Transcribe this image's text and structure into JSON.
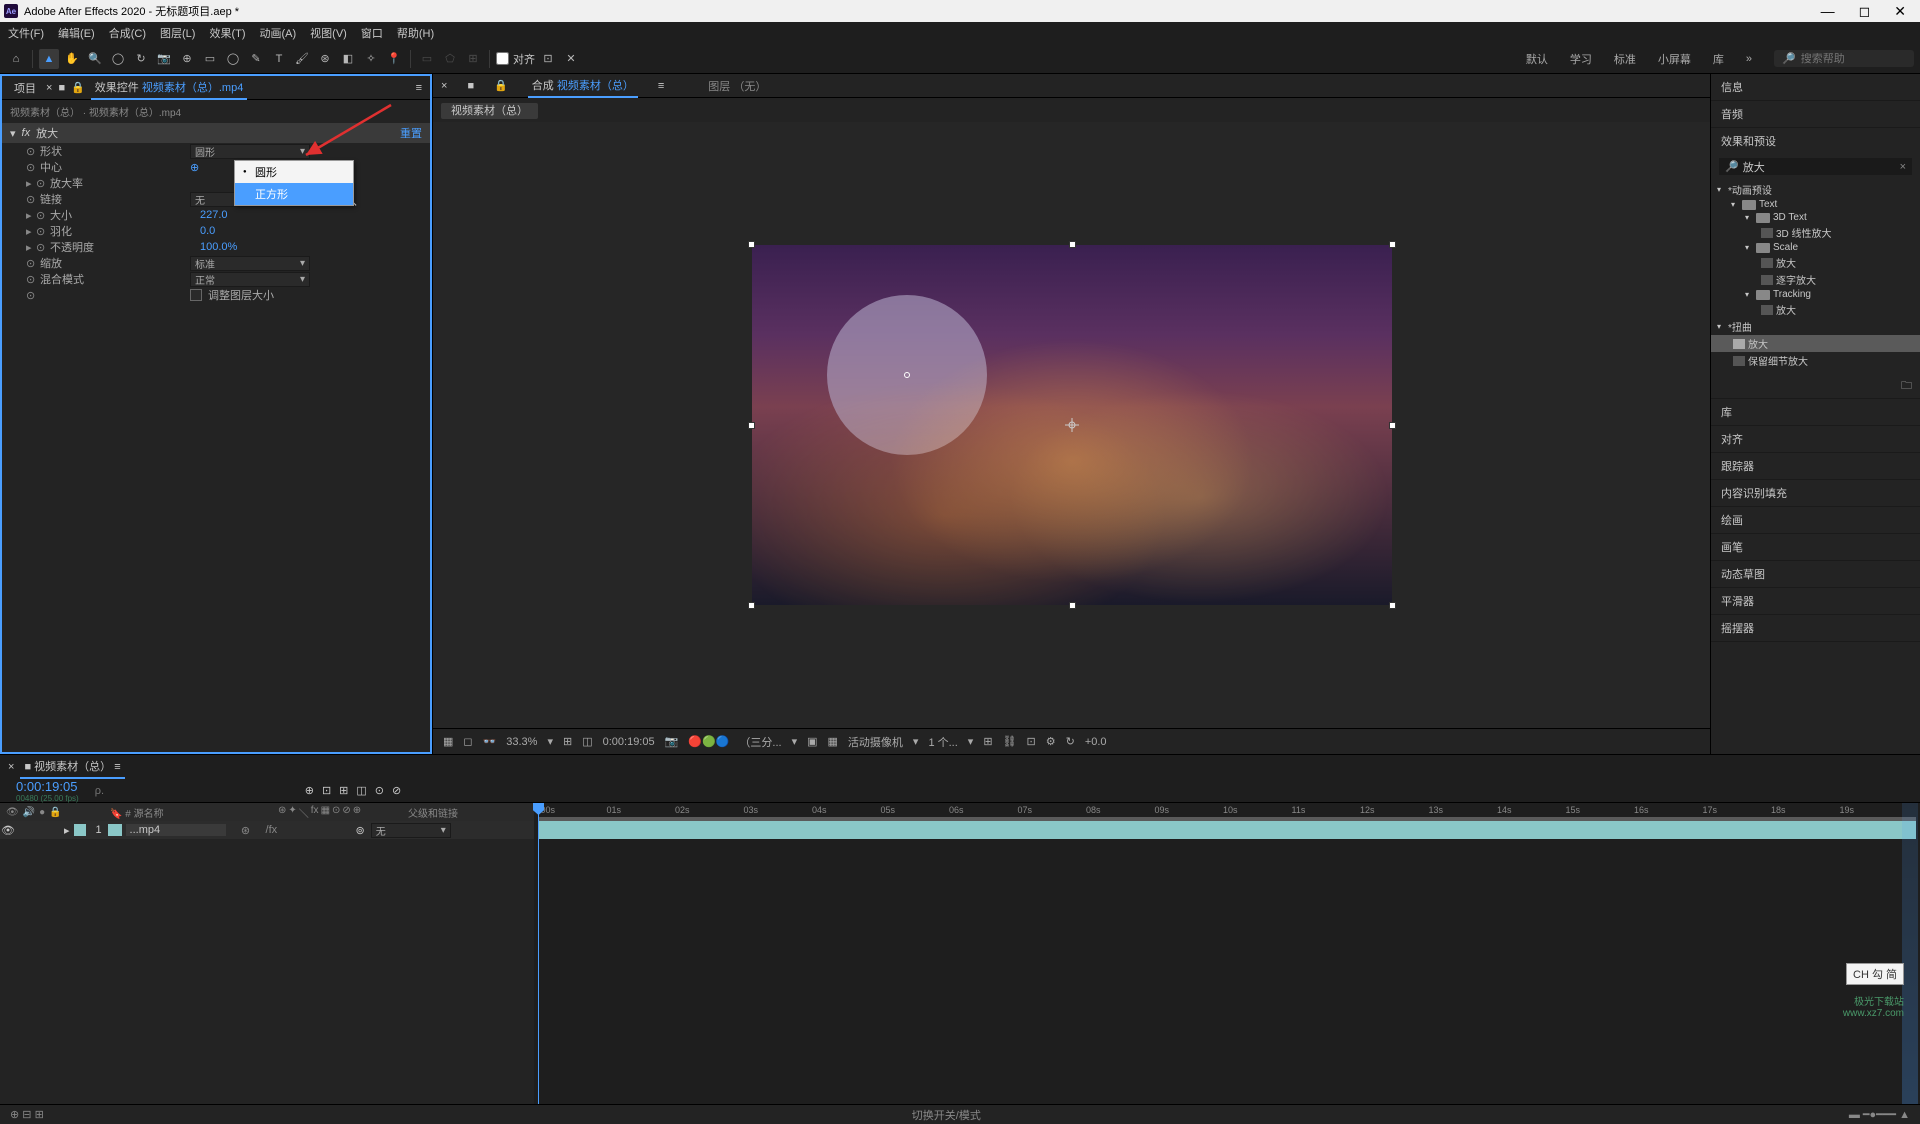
{
  "titlebar": {
    "app": "Adobe After Effects 2020",
    "doc": "无标题项目.aep *",
    "ae": "Ae"
  },
  "menu": [
    "文件(F)",
    "编辑(E)",
    "合成(C)",
    "图层(L)",
    "效果(T)",
    "动画(A)",
    "视图(V)",
    "窗口",
    "帮助(H)"
  ],
  "toolbar": {
    "align": "对齐",
    "workspaces": [
      "默认",
      "学习",
      "标准",
      "小屏幕",
      "库"
    ],
    "search_ph": "搜索帮助"
  },
  "left": {
    "tabs": {
      "project": "项目",
      "controls_prefix": "效果控件",
      "controls_link": "视频素材（总）.mp4"
    },
    "sub": "视频素材（总） · 视频素材（总）.mp4",
    "effect_name": "放大",
    "reset": "重置",
    "props": {
      "shape": "形状",
      "shape_val": "圆形",
      "center": "中心",
      "mag": "放大率",
      "link": "链接",
      "link_val": "无",
      "size": "大小",
      "size_val": "227.0",
      "feather": "羽化",
      "feather_val": "0.0",
      "opacity": "不透明度",
      "opacity_val": "100.0%",
      "scaling": "缩放",
      "scaling_val": "标准",
      "blend": "混合模式",
      "blend_val": "正常",
      "resize": "调整图层大小"
    },
    "dropdown": {
      "opt1": "圆形",
      "opt2": "正方形"
    }
  },
  "center": {
    "tabs": {
      "comp_prefix": "合成",
      "comp_link": "视频素材（总）",
      "layer": "图层 （无）"
    },
    "sub_comp": "视频素材（总）",
    "footer": {
      "zoom": "33.3%",
      "time": "0:00:19:05",
      "res": "（三分...",
      "camera": "活动摄像机",
      "views": "1 个...",
      "exposure": "+0.0"
    }
  },
  "right": {
    "sections": [
      "信息",
      "音频",
      "效果和预设",
      "库",
      "对齐",
      "跟踪器",
      "内容识别填充",
      "绘画",
      "画笔",
      "动态草图",
      "平滑器",
      "摇摆器"
    ],
    "search_val": "放大",
    "tree": {
      "anim": "*动画预设",
      "text": "Text",
      "text3d": "3D Text",
      "linear": "3D 线性放大",
      "scale": "Scale",
      "scale_1": "放大",
      "scale_2": "逐字放大",
      "tracking": "Tracking",
      "tracking_1": "放大",
      "distort": "*扭曲",
      "distort_1": "放大",
      "distort_2": "保留细节放大"
    }
  },
  "timeline": {
    "tab": "视频素材（总）",
    "time": "0:00:19:05",
    "time_sub": "00480 (25.00 fps)",
    "search_ph": "ρ.",
    "cols": {
      "source": "源名称",
      "parent": "父级和链接"
    },
    "layer": {
      "num": "1",
      "name": "...mp4",
      "fx": "/fx",
      "parent": "无"
    },
    "ticks": [
      ":00s",
      "01s",
      "02s",
      "03s",
      "04s",
      "05s",
      "06s",
      "07s",
      "08s",
      "09s",
      "10s",
      "11s",
      "12s",
      "13s",
      "14s",
      "15s",
      "16s",
      "17s",
      "18s",
      "19s"
    ],
    "footer": "切换开关/模式"
  },
  "ime": "CH 勾 简",
  "watermark": {
    "l1": "极光下载站",
    "l2": "www.xz7.com"
  }
}
